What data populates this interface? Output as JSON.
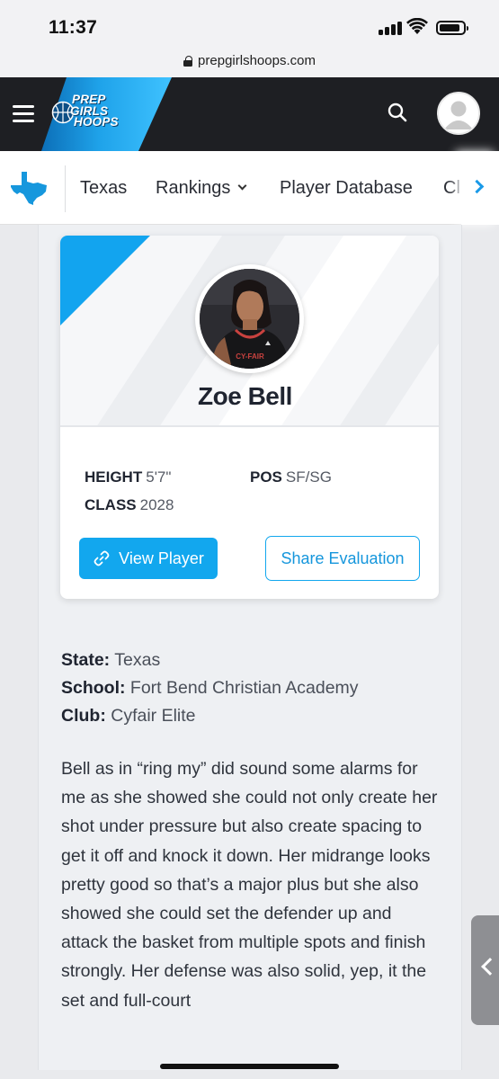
{
  "status_bar": {
    "time": "11:37"
  },
  "browser": {
    "url": "prepgirlshoops.com"
  },
  "header": {
    "logo_lines": [
      "PREP",
      "GIRLS",
      "HOOPS"
    ],
    "brand_color": "#1fa3ea"
  },
  "nav": {
    "state_label": "Texas",
    "rankings_label": "Rankings",
    "player_database_label": "Player Database",
    "truncated_label": "Cl"
  },
  "player": {
    "name": "Zoe Bell",
    "height_label": "HEIGHT",
    "height_value": "5'7\"",
    "pos_label": "POS",
    "pos_value": "SF/SG",
    "class_label": "CLASS",
    "class_value": "2028",
    "view_button": "View Player",
    "share_button": "Share Evaluation"
  },
  "details": {
    "state_label": "State:",
    "state_value": "Texas",
    "school_label": "School:",
    "school_value": "Fort Bend Christian Academy",
    "club_label": "Club:",
    "club_value": "Cyfair Elite"
  },
  "evaluation": "Bell as in “ring my” did sound some alarms for me as she showed she could not only create her shot under pressure but also create spacing to get it off and knock it down. Her midrange looks pretty good so that’s a major plus but she also showed she could set the defender up and attack the basket from multiple spots and finish strongly. Her defense was also solid, yep, it the set and full-court"
}
